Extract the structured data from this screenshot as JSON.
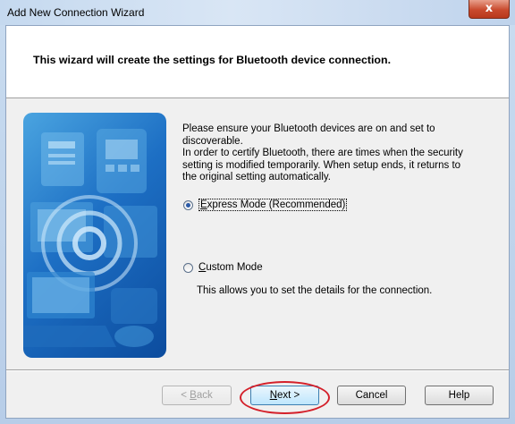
{
  "window": {
    "title": "Add New Connection Wizard",
    "close_glyph": "x"
  },
  "header": {
    "text": "This wizard will create the settings for Bluetooth device connection."
  },
  "content": {
    "line1": "Please ensure your Bluetooth devices are on and set to",
    "line2": "discoverable.",
    "line3": "In order to certify Bluetooth, there are times when the security",
    "line4": "setting is modified temporarily. When setup ends, it returns to",
    "line5": "the original setting automatically."
  },
  "options": {
    "express": {
      "accel": "E",
      "label_rest": "xpress Mode (Recommended)",
      "selected": true
    },
    "custom": {
      "accel": "C",
      "label_rest": "ustom Mode",
      "selected": false,
      "description": "This allows you to set the details for the connection."
    }
  },
  "buttons": {
    "back": {
      "prefix": "< ",
      "accel": "B",
      "rest": "ack",
      "enabled": false
    },
    "next": {
      "accel": "N",
      "rest": "ext >"
    },
    "cancel": {
      "label": "Cancel"
    },
    "help": {
      "label": "Help"
    }
  },
  "colors": {
    "highlight_ellipse": "#d4202a",
    "graphic_blue": "#1d6fc4"
  },
  "icons": {
    "radio_checked": "radio-checked-icon",
    "radio_unchecked": "radio-unchecked-icon"
  }
}
